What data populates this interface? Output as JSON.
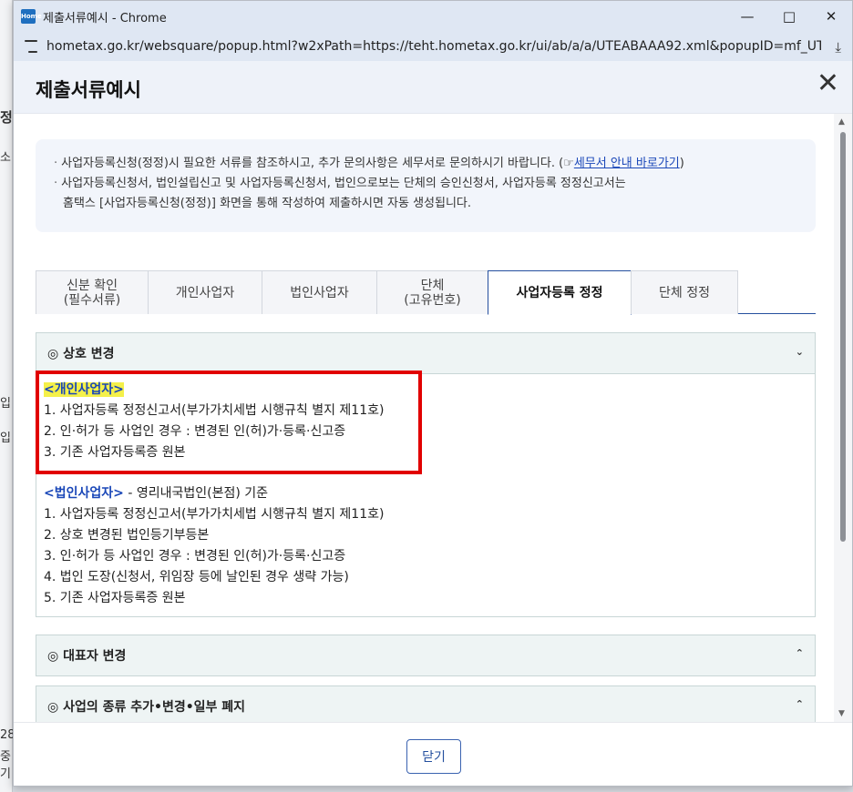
{
  "window": {
    "title": "제출서류예시 - Chrome",
    "url": "hometax.go.kr/websquare/popup.html?w2xPath=https://teht.hometax.go.kr/ui/ab/a/a/UTEABAAA92.xml&popupID=mf_UTEABAA...",
    "logo_text": "Home"
  },
  "background": {
    "left_fragments": [
      "정",
      "소",
      "입",
      "입",
      "28",
      "중기"
    ]
  },
  "popup": {
    "title": "제출서류예시",
    "notice": {
      "line1_before": "사업자등록신청(정정)시 필요한 서류를 참조하시고, 추가 문의사항은 세무서로 문의하시기 바랍니다. (",
      "line1_link_icon": "☞",
      "line1_link": "세무서 안내 바로가기",
      "line1_after": ")",
      "line2": "사업자등록신청서, 법인설립신고 및 사업자등록신청서, 법인으로보는 단체의 승인신청서, 사업자등록 정정신고서는",
      "line3": "홈택스 [사업자등록신청(정정)] 화면을 통해 작성하여 제출하시면 자동 생성됩니다."
    },
    "tabs": [
      {
        "line1": "신분 확인",
        "line2": "(필수서류)"
      },
      {
        "line1": "개인사업자",
        "line2": ""
      },
      {
        "line1": "법인사업자",
        "line2": ""
      },
      {
        "line1": "단체",
        "line2": "(고유번호)"
      },
      {
        "line1": "사업자등록 정정",
        "line2": ""
      },
      {
        "line1": "단체 정정",
        "line2": ""
      }
    ],
    "active_tab": "사업자등록 정정",
    "sections": [
      {
        "title": "◎ 상호 변경",
        "expanded": true,
        "individual_head": "<개인사업자>",
        "individual_items": [
          "1. 사업자등록 정정신고서(부가가치세법 시행규칙 별지 제11호)",
          "2. 인·허가 등 사업인 경우 : 변경된 인(허)가·등록·신고증",
          "3. 기존 사업자등록증 원본"
        ],
        "corporate_head": "<법인사업자>",
        "corporate_suffix": " - 영리내국법인(본점) 기준",
        "corporate_items": [
          "1. 사업자등록 정정신고서(부가가치세법 시행규칙 별지 제11호)",
          "2. 상호 변경된 법인등기부등본",
          "3. 인·허가 등 사업인 경우 : 변경된 인(허)가·등록·신고증",
          "4. 법인 도장(신청서, 위임장 등에 날인된 경우 생략 가능)",
          "5. 기존 사업자등록증 원본"
        ]
      },
      {
        "title": "◎ 대표자 변경",
        "expanded": false
      },
      {
        "title": "◎ 사업의 종류 추가•변경•일부 폐지",
        "expanded": false
      }
    ],
    "close_button": "닫기"
  }
}
